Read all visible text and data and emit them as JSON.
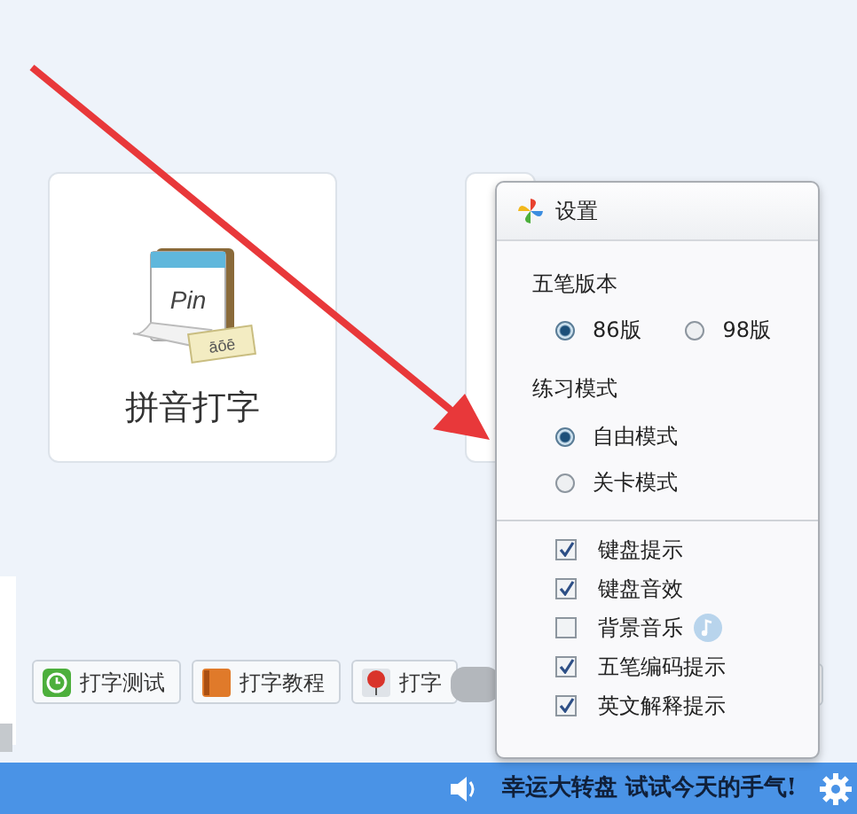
{
  "cards": [
    {
      "label": "拼音打字",
      "icon_word": "Pin",
      "icon_letters": "āōē"
    }
  ],
  "buttons": [
    {
      "label": "打字测试",
      "kind": "clock"
    },
    {
      "label": "打字教程",
      "kind": "book"
    },
    {
      "label": "打字",
      "kind": "balloon"
    }
  ],
  "settings": {
    "title": "设置",
    "sections": [
      {
        "heading": "五笔版本",
        "kind": "row",
        "options": [
          {
            "label": "86版",
            "selected": true
          },
          {
            "label": "98版",
            "selected": false
          }
        ]
      },
      {
        "heading": "练习模式",
        "kind": "column",
        "options": [
          {
            "label": "自由模式",
            "selected": true
          },
          {
            "label": "关卡模式",
            "selected": false
          }
        ]
      }
    ],
    "checkboxes": [
      {
        "label": "键盘提示",
        "checked": true
      },
      {
        "label": "键盘音效",
        "checked": true
      },
      {
        "label": "背景音乐",
        "checked": false,
        "note": true
      },
      {
        "label": "五笔编码提示",
        "checked": true
      },
      {
        "label": "英文解释提示",
        "checked": true
      }
    ]
  },
  "status_bar": {
    "promo": "幸运大转盘 试试今天的手气!"
  }
}
